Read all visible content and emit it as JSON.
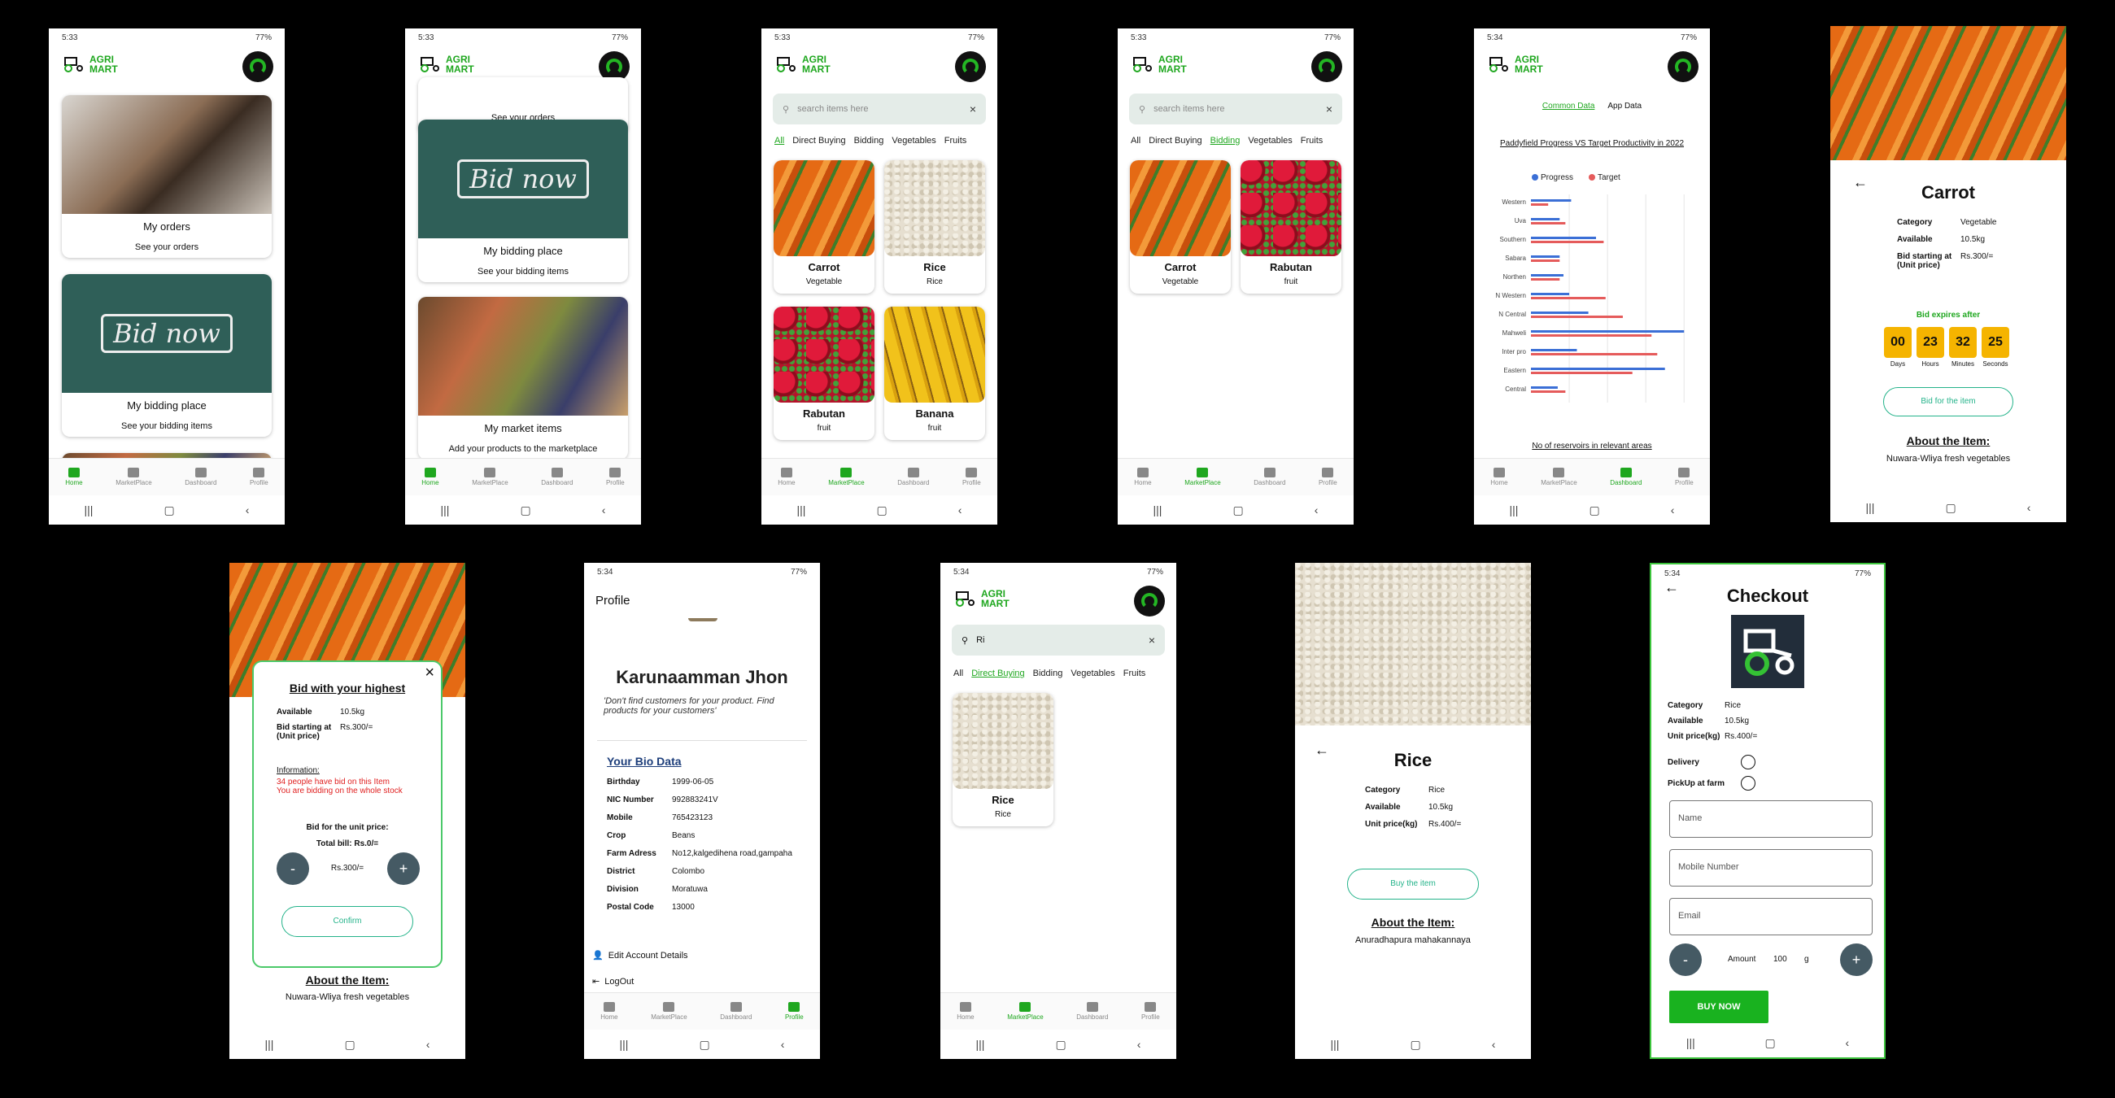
{
  "common": {
    "time_a": "5:33",
    "time_b": "5:34",
    "battery": "77%",
    "brand_line1": "AGRI",
    "brand_line2": "MART",
    "nav": {
      "home": "Home",
      "market": "MarketPlace",
      "dashboard": "Dashboard",
      "profile": "Profile"
    },
    "sys": {
      "recents": "|||",
      "home": "▢",
      "back": "‹"
    }
  },
  "home": {
    "orders_title": "My orders",
    "orders_sub": "See your orders",
    "bid_title": "My bidding place",
    "bid_sub": "See your bidding items",
    "market_title": "My market items",
    "market_sub": "Add your products to the marketplace",
    "board_text": "Bid now"
  },
  "market": {
    "search_placeholder": "search items here",
    "tabs": [
      "All",
      "Direct Buying",
      "Bidding",
      "Vegetables",
      "Fruits"
    ],
    "products": [
      {
        "name": "Carrot",
        "cat": "Vegetable"
      },
      {
        "name": "Rice",
        "cat": "Rice"
      },
      {
        "name": "Rabutan",
        "cat": "fruit"
      },
      {
        "name": "Banana",
        "cat": "fruit"
      }
    ],
    "search_query": "Ri"
  },
  "dashboard": {
    "tab_common": "Common Data",
    "tab_app": "App Data",
    "chart_title": "Paddyfield Progress VS Target Productivity in 2022",
    "footer": "No of reservoirs in relevant areas",
    "colors": {
      "progress": "#3b6fd6",
      "target": "#e55b5b"
    }
  },
  "chart_data": {
    "type": "bar",
    "orientation": "horizontal",
    "title": "Paddyfield Progress VS Target Productivity in 2022",
    "xlabel": "No of reservoirs in relevant areas",
    "categories": [
      "Western",
      "Uva",
      "Southern",
      "Sabara",
      "Northen",
      "N Western",
      "N Central",
      "Mahweli",
      "Inter pro",
      "Eastern",
      "Central"
    ],
    "series": [
      {
        "name": "Progress",
        "values": [
          21000,
          15000,
          34000,
          15000,
          17000,
          20000,
          30000,
          80000,
          24000,
          70000,
          14000
        ]
      },
      {
        "name": "Target",
        "values": [
          9000,
          18000,
          38000,
          15000,
          15000,
          39000,
          48000,
          63000,
          66000,
          53000,
          18000
        ]
      }
    ],
    "xlim": [
      0,
      85000
    ],
    "xticks": [
      "20,000",
      "40,000",
      "60,000",
      "80,000"
    ],
    "legend": "top-left"
  },
  "carrot_detail": {
    "name": "Carrot",
    "category_label": "Category",
    "category": "Vegetable",
    "available_label": "Available",
    "available": "10.5kg",
    "bid_label": "Bid starting at (Unit price)",
    "bid": "Rs.300/=",
    "expires": "Bid expires after",
    "timer": [
      {
        "v": "00",
        "l": "Days"
      },
      {
        "v": "23",
        "l": "Hours"
      },
      {
        "v": "32",
        "l": "Minutes"
      },
      {
        "v": "25",
        "l": "Seconds"
      }
    ],
    "bid_btn": "Bid for the item",
    "about": "About the Item:",
    "about_text": "Nuwara-Wliya fresh vegetables"
  },
  "bid_modal": {
    "title": "Bid with your highest",
    "available_label": "Available",
    "available": "10.5kg",
    "bid_label": "Bid starting at (Unit price)",
    "bid": "Rs.300/=",
    "info_label": "Information:",
    "info1": "34 people have bid on this Item",
    "info2": "You are bidding on the whole stock",
    "unit_label": "Bid for the unit price:",
    "total": "Total bill: Rs.0/=",
    "price": "Rs.300/=",
    "minus": "-",
    "plus": "+",
    "confirm": "Confirm",
    "about": "About the Item:",
    "about_text": "Nuwara-Wliya fresh vegetables"
  },
  "profile": {
    "title": "Profile",
    "name": "Karunaamman Jhon",
    "quote": "'Don't find customers for your product. Find products for your customers'",
    "bio": "Your Bio Data",
    "fields": [
      {
        "k": "Birthday",
        "v": "1999-06-05"
      },
      {
        "k": "NIC Number",
        "v": "992883241V"
      },
      {
        "k": "Mobile",
        "v": "765423123"
      },
      {
        "k": "Crop",
        "v": "Beans"
      },
      {
        "k": "Farm Adress",
        "v": "No12,kalgedihena road,gampaha"
      },
      {
        "k": "District",
        "v": "Colombo"
      },
      {
        "k": "Division",
        "v": "Moratuwa"
      },
      {
        "k": "Postal Code",
        "v": "13000"
      }
    ],
    "edit": "Edit Account Details",
    "logout": "LogOut"
  },
  "rice_detail": {
    "name": "Rice",
    "category_label": "Category",
    "category": "Rice",
    "available_label": "Available",
    "available": "10.5kg",
    "price_label": "Unit price(kg)",
    "price": "Rs.400/=",
    "buy": "Buy the item",
    "about": "About the Item:",
    "about_text": "Anuradhapura mahakannaya"
  },
  "checkout": {
    "title": "Checkout",
    "category_label": "Category",
    "category": "Rice",
    "available_label": "Available",
    "available": "10.5kg",
    "price_label": "Unit price(kg)",
    "price": "Rs.400/=",
    "delivery": "Delivery",
    "pickup": "PickUp at farm",
    "name_ph": "Name",
    "mobile_ph": "Mobile Number",
    "email_ph": "Email",
    "amount_label": "Amount",
    "amount": "100",
    "unit": "g",
    "buy": "BUY NOW"
  }
}
